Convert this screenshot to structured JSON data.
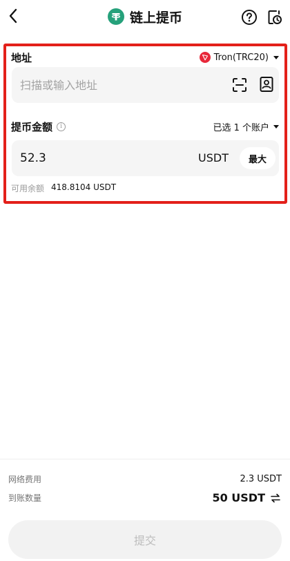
{
  "header": {
    "title": "链上提币",
    "coin_icon": "tether-icon",
    "coin_color": "#26A17B"
  },
  "address": {
    "label": "地址",
    "network": "Tron(TRC20)",
    "network_color": "#e8283a",
    "placeholder": "扫描或输入地址",
    "value": ""
  },
  "amount": {
    "label": "提币金额",
    "account_selector": "已选 1 个账户",
    "value": "52.3",
    "unit": "USDT",
    "max_label": "最大",
    "available_label": "可用余额",
    "available_value": "418.8104 USDT"
  },
  "footer": {
    "fee_label": "网络费用",
    "fee_value": "2.3 USDT",
    "receive_label": "到账数量",
    "receive_value": "50 USDT",
    "submit_label": "提交"
  },
  "colors": {
    "highlight_border": "#e3201a"
  }
}
